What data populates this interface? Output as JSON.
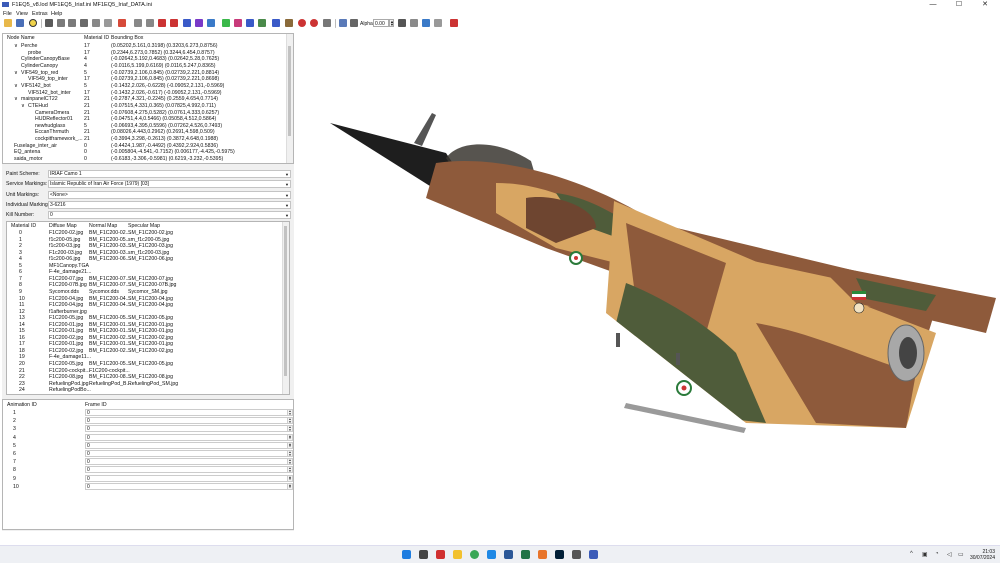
{
  "window": {
    "title": "F1EQ5_v8.lod  MF1EQ5_Iriaf.ini  MF1EQ5_Iriaf_DATA.ini",
    "controls": [
      "—",
      "☐",
      "✕"
    ]
  },
  "menu": [
    "File",
    "View",
    "Extras",
    "Help"
  ],
  "toolbar": {
    "alpha_label": "Alpha:",
    "alpha_value": "0.00"
  },
  "node_tree": {
    "headers": [
      "Node Name",
      "Material ID",
      "Bounding Box"
    ],
    "rows": [
      {
        "name": "Perche",
        "indent": 2,
        "expander": "∨",
        "mat": "17",
        "box": "(0.05202,5.161,0.3198) (0.3203,6.273,0.8756)"
      },
      {
        "name": "probe",
        "indent": 3,
        "expander": "",
        "mat": "17",
        "box": "(0.2344,6.273,0.7852) (0.3244,6.454,0.8757)"
      },
      {
        "name": "CylinderCanopyBase",
        "indent": 2,
        "expander": "",
        "mat": "4",
        "box": "(-0.02642,5.192,0.4683) (0.02642,5.28,0.7625)"
      },
      {
        "name": "CylinderCanopy",
        "indent": 2,
        "expander": "",
        "mat": "4",
        "box": "(-0.0116,5.199,0.6169) (0.0116,5.247,0.8365)"
      },
      {
        "name": "VIF549_top_red",
        "indent": 2,
        "expander": "∨",
        "mat": "5",
        "box": "(-0.02739,2.106,0.845) (0.02739,2.221,0.8814)"
      },
      {
        "name": "VIF549_top_inter",
        "indent": 3,
        "expander": "",
        "mat": "17",
        "box": "(-0.02739,2.106,0.845) (0.02739,2.221,0.8698)"
      },
      {
        "name": "VIF5142_bot",
        "indent": 2,
        "expander": "∨",
        "mat": "5",
        "box": "(-0.1432,2.026,-0.6228) (-0.09052,2.131,-0.5969)"
      },
      {
        "name": "VIF5142_bot_inter",
        "indent": 3,
        "expander": "",
        "mat": "17",
        "box": "(-0.1432,2.026,-0.617) (-0.09052,2.131,-0.5969)"
      },
      {
        "name": "mainpanelCT22",
        "indent": 2,
        "expander": "∨",
        "mat": "21",
        "box": "(-0.2787,4.321,-0.2245) (0.2559,4.654,0.7714)"
      },
      {
        "name": "CTEHud",
        "indent": 3,
        "expander": "∨",
        "mat": "21",
        "box": "(-0.07515,4.331,0.365) (0.07825,4.992,0.711)"
      },
      {
        "name": "CameraOmera",
        "indent": 4,
        "expander": "",
        "mat": "21",
        "box": "(-0.07608,4.275,0.5282) (0.0761,4.333,0.6257)"
      },
      {
        "name": "HUDReflector01",
        "indent": 4,
        "expander": "",
        "mat": "21",
        "box": "(-0.04751,4.4,0.5466) (0.05058,4.512,0.5864)"
      },
      {
        "name": "newhudglass",
        "indent": 4,
        "expander": "",
        "mat": "5",
        "box": "(-0.06693,4.395,0.5596) (0.07262,4.526,0.7493)"
      },
      {
        "name": "EccanThrmuth",
        "indent": 4,
        "expander": "",
        "mat": "21",
        "box": "(0.08026,4.443,0.2962) (0.2691,4.598,0.509)"
      },
      {
        "name": "cockpitframework_...",
        "indent": 4,
        "expander": "",
        "mat": "21",
        "box": "(-0.3994,3.298,-0.2613) (0.3872,4.648,0.1988)"
      },
      {
        "name": "Fuselage_inter_air",
        "indent": 1,
        "expander": "",
        "mat": "0",
        "box": "(-0.4424,1.987,-0.4492) (0.4392,2.924,0.5836)"
      },
      {
        "name": "EQ_antena",
        "indent": 1,
        "expander": "",
        "mat": "0",
        "box": "(-0.005804,-4.541,-0.7152) (0.006177,-4.425,-0.5975)"
      },
      {
        "name": "saida_motor",
        "indent": 1,
        "expander": "",
        "mat": "0",
        "box": "(-0.6183,-3.306,-0.5981) (0.6219,-3.232,-0.5395)"
      }
    ]
  },
  "settings": [
    {
      "label": "Paint Scheme:",
      "value": "IRIAF Camo 1"
    },
    {
      "label": "Service Markings:",
      "value": "Islamic Republic of Iran Air Force (1979) [03]"
    },
    {
      "label": "Unit Markings:",
      "value": "<None>"
    },
    {
      "label": "Individual Markings:",
      "value": "3-6216"
    },
    {
      "label": "Kill Number:",
      "value": "0"
    }
  ],
  "materials": {
    "headers": [
      "Material ID",
      "Diffuse Map",
      "Normal Map",
      "Specular Map"
    ],
    "rows": [
      [
        "0",
        "F1C200-02.jpg",
        "BM_F1C200-02...",
        "SM_F1C200-02.jpg"
      ],
      [
        "1",
        "f1c200-05.jpg",
        "BM_F1C200-05...",
        "sm_f1c200-05.jpg"
      ],
      [
        "2",
        "f1c200-03.jpg",
        "BM_F1C200-03...",
        "SM_F1C200-03.jpg"
      ],
      [
        "3",
        "F1c200-03.jpg",
        "BM_F1C200-03...",
        "sm_f1c200-03.jpg"
      ],
      [
        "4",
        "f1c200-06.jpg",
        "BM_F1C200-06...",
        "SM_F1C200-06.jpg"
      ],
      [
        "5",
        "MF1Canopy.TGA",
        "",
        ""
      ],
      [
        "6",
        "F-4e_damage21...",
        "",
        ""
      ],
      [
        "7",
        "F1C200-07.jpg",
        "BM_F1C200-07...",
        "SM_F1C200-07.jpg"
      ],
      [
        "8",
        "F1C200-07B.jpg",
        "BM_F1C200-07...",
        "SM_F1C200-07B.jpg"
      ],
      [
        "9",
        "Sycomor.dds",
        "Sycomor.dds",
        "Sycomor_SM.jpg"
      ],
      [
        "10",
        "F1C200-04.jpg",
        "BM_F1C200-04...",
        "SM_F1C200-04.jpg"
      ],
      [
        "11",
        "F1C200-04.jpg",
        "BM_F1C200-04...",
        "SM_F1C200-04.jpg"
      ],
      [
        "12",
        "f1afterburner.jpg",
        "",
        ""
      ],
      [
        "13",
        "F1C200-05.jpg",
        "BM_F1C200-05...",
        "SM_F1C200-05.jpg"
      ],
      [
        "14",
        "F1C200-01.jpg",
        "BM_F1C200-01...",
        "SM_F1C200-01.jpg"
      ],
      [
        "15",
        "F1C200-01.jpg",
        "BM_F1C200-01...",
        "SM_F1C200-01.jpg"
      ],
      [
        "16",
        "F1C200-02.jpg",
        "BM_F1C200-02...",
        "SM_F1C200-02.jpg"
      ],
      [
        "17",
        "F1C200-01.jpg",
        "BM_F1C200-01...",
        "SM_F1C200-01.jpg"
      ],
      [
        "18",
        "F1C200-02.jpg",
        "BM_F1C200-02...",
        "SM_F1C200-02.jpg"
      ],
      [
        "19",
        "F-4e_damage11...",
        "",
        ""
      ],
      [
        "20",
        "F1C200-05.jpg",
        "BM_F1C200-05...",
        "SM_F1C200-05.jpg"
      ],
      [
        "21",
        "F1C200-cockpit...",
        "F1C200-cockpit...",
        ""
      ],
      [
        "22",
        "F1C200-08.jpg",
        "BM_F1C200-08...",
        "SM_F1C200-08.jpg"
      ],
      [
        "23",
        "RefuelingPod.jpg",
        "RefuelingPod_B...",
        "RefuelingPod_SM.jpg"
      ],
      [
        "24",
        "RefuelingPodBo...",
        "",
        ""
      ]
    ]
  },
  "animations": {
    "headers": [
      "Animation ID",
      "Frame ID"
    ],
    "rows": [
      [
        "1",
        "0"
      ],
      [
        "2",
        "0"
      ],
      [
        "3",
        "0"
      ],
      [
        "4",
        "0"
      ],
      [
        "5",
        "0"
      ],
      [
        "6",
        "0"
      ],
      [
        "7",
        "0"
      ],
      [
        "8",
        "0"
      ],
      [
        "9",
        "0"
      ],
      [
        "10",
        "0"
      ]
    ]
  },
  "taskbar": {
    "time": "21:03",
    "date": "30/07/2024"
  },
  "colors": {
    "camo_tan": "#d8a663",
    "camo_brown": "#8e5a3b",
    "camo_green": "#4f5c3a",
    "nose": "#1e1e1e"
  }
}
